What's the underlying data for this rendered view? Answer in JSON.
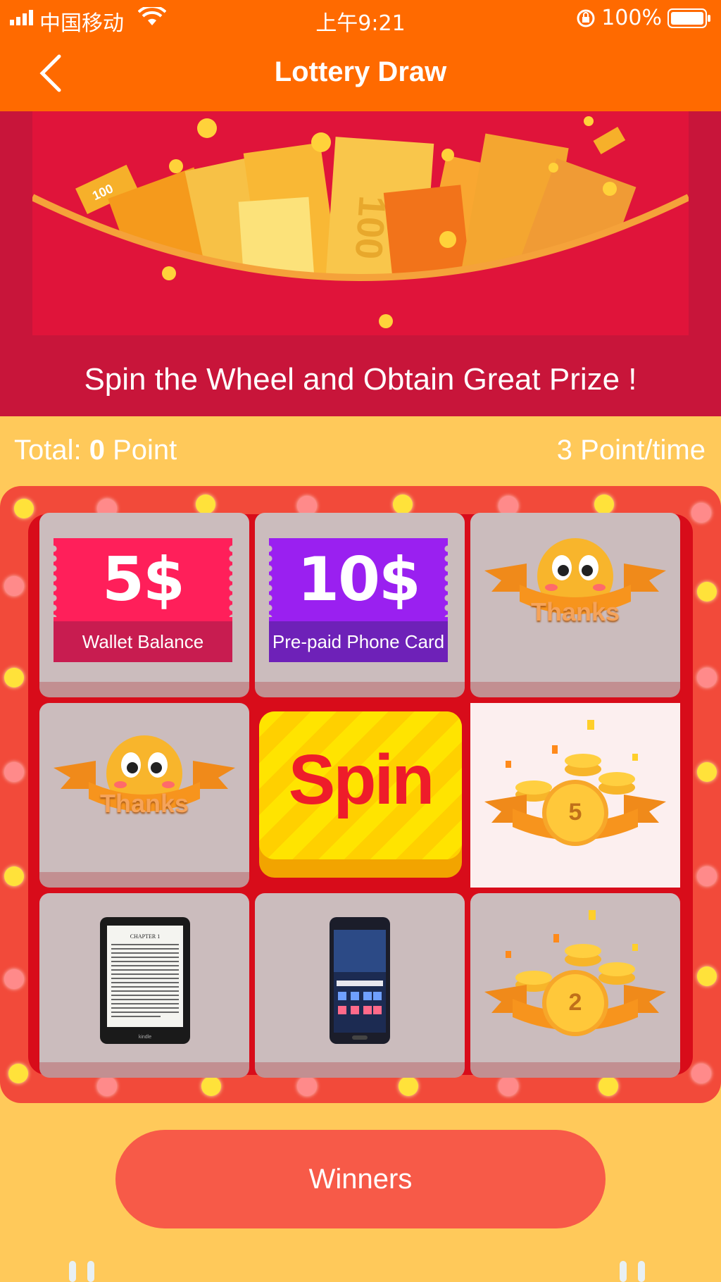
{
  "status_bar": {
    "carrier": "中国移动",
    "time": "上午9:21",
    "battery": "100%"
  },
  "nav": {
    "title": "Lottery Draw"
  },
  "banner": {
    "tagline": "Spin the Wheel and Obtain Great Prize !",
    "ticket_text": "100"
  },
  "points": {
    "prefix": "Total:",
    "value": "0",
    "suffix": "Point",
    "cost": "3 Point/time"
  },
  "prizes": {
    "wallet": {
      "amount": "5$",
      "label": "Wallet Balance"
    },
    "phone_card": {
      "amount": "10$",
      "label": "Pre-paid Phone Card"
    },
    "thanks_1": "Thanks",
    "thanks_2": "Thanks",
    "coins_5": "5",
    "coins_2": "2",
    "kindle_title": "CHAPTER 1",
    "kindle_brand": "kindle"
  },
  "spin": {
    "label": "Spin"
  },
  "winners": {
    "label": "Winners"
  },
  "colors": {
    "accent": "#ff6a00",
    "board": "#f24a3a",
    "background": "#ffc95a"
  }
}
